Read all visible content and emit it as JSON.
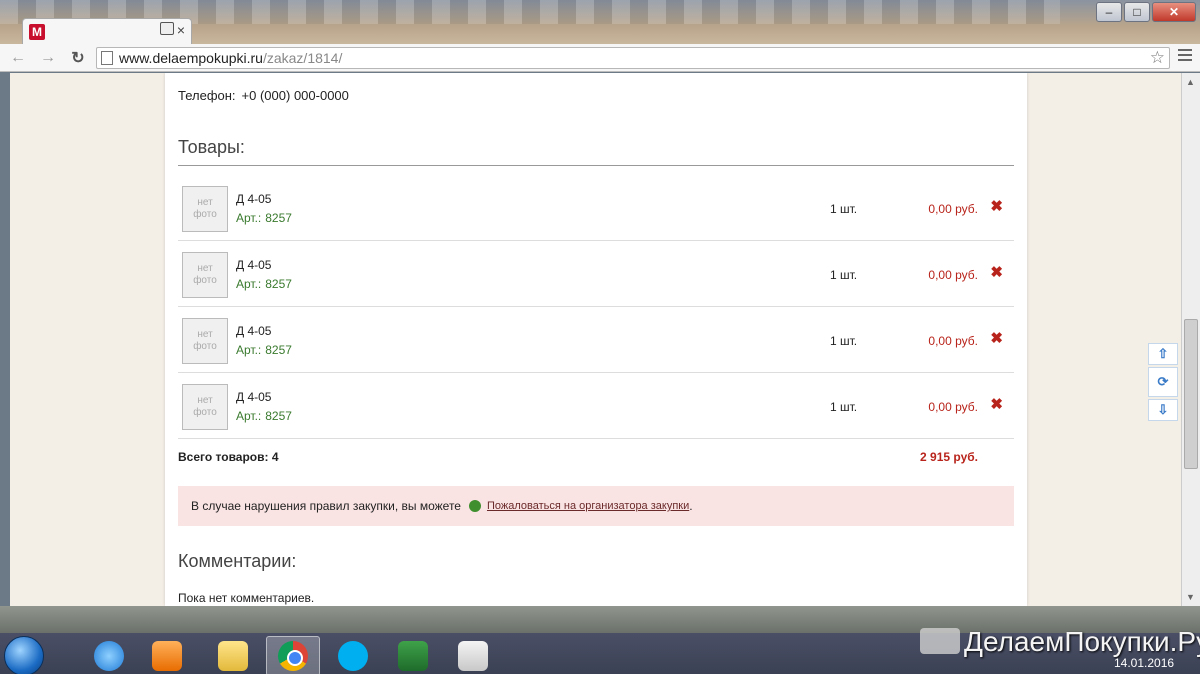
{
  "browser": {
    "tab_favicon_letter": "M",
    "tab_close": "×",
    "url_host": "www.delaempokupki.ru",
    "url_path": "/zakaz/1814/",
    "nav": {
      "back": "←",
      "forward": "→",
      "reload": "↻",
      "star": "☆"
    },
    "window": {
      "minimize": "–",
      "maximize": "□",
      "close": "✕"
    }
  },
  "page": {
    "phone_label": "Телефон:",
    "phone_value": "+0 (000) 000-0000",
    "goods_title": "Товары:",
    "no_photo_line1": "нет",
    "no_photo_line2": "фото",
    "items": [
      {
        "name": "Д 4-05",
        "art_label": "Арт.:",
        "art": "8257",
        "qty": "1 шт.",
        "price": "0,00 руб."
      },
      {
        "name": "Д 4-05",
        "art_label": "Арт.:",
        "art": "8257",
        "qty": "1 шт.",
        "price": "0,00 руб."
      },
      {
        "name": "Д 4-05",
        "art_label": "Арт.:",
        "art": "8257",
        "qty": "1 шт.",
        "price": "0,00 руб."
      },
      {
        "name": "Д 4-05",
        "art_label": "Арт.:",
        "art": "8257",
        "qty": "1 шт.",
        "price": "0,00 руб."
      }
    ],
    "delete_glyph": "✖",
    "total_label": "Всего товаров: 4",
    "total_sum": "2 915 руб.",
    "alert_text": "В случае нарушения правил закупки, вы можете",
    "alert_link": "Пожаловаться на организатора закупки",
    "alert_end": ".",
    "comments_title": "Комментарии:",
    "no_comments": "Пока нет комментариев."
  },
  "float_nav": {
    "up": "⇧",
    "refresh": "⟳",
    "down": "⇩"
  },
  "taskbar": {
    "watermark": "ДелаемПокупки.Ру",
    "date": "14.01.2016"
  },
  "colors": {
    "price_red": "#b8241b",
    "art_green": "#3a7a2e",
    "alert_bg": "#fae3e3"
  }
}
